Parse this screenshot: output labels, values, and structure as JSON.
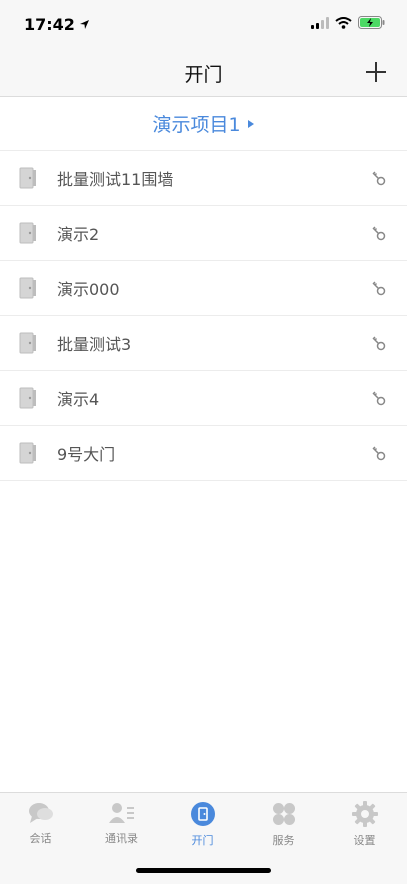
{
  "status_bar": {
    "time": "17:42"
  },
  "nav": {
    "title": "开门",
    "add_icon": "plus-icon"
  },
  "project": {
    "name": "演示项目1"
  },
  "doors": [
    {
      "name": "批量测试11围墙"
    },
    {
      "name": "演示2"
    },
    {
      "name": "演示000"
    },
    {
      "name": "批量测试3"
    },
    {
      "name": "演示4"
    },
    {
      "name": "9号大门"
    }
  ],
  "tabs": [
    {
      "label": "会话",
      "icon": "chat-icon",
      "active": false
    },
    {
      "label": "通讯录",
      "icon": "contacts-icon",
      "active": false
    },
    {
      "label": "开门",
      "icon": "door-icon",
      "active": true
    },
    {
      "label": "服务",
      "icon": "services-icon",
      "active": false
    },
    {
      "label": "设置",
      "icon": "gear-icon",
      "active": false
    }
  ],
  "colors": {
    "accent": "#4a89dc",
    "inactive_icon": "#c8c8c8",
    "door_icon": "#bdbdbd"
  }
}
